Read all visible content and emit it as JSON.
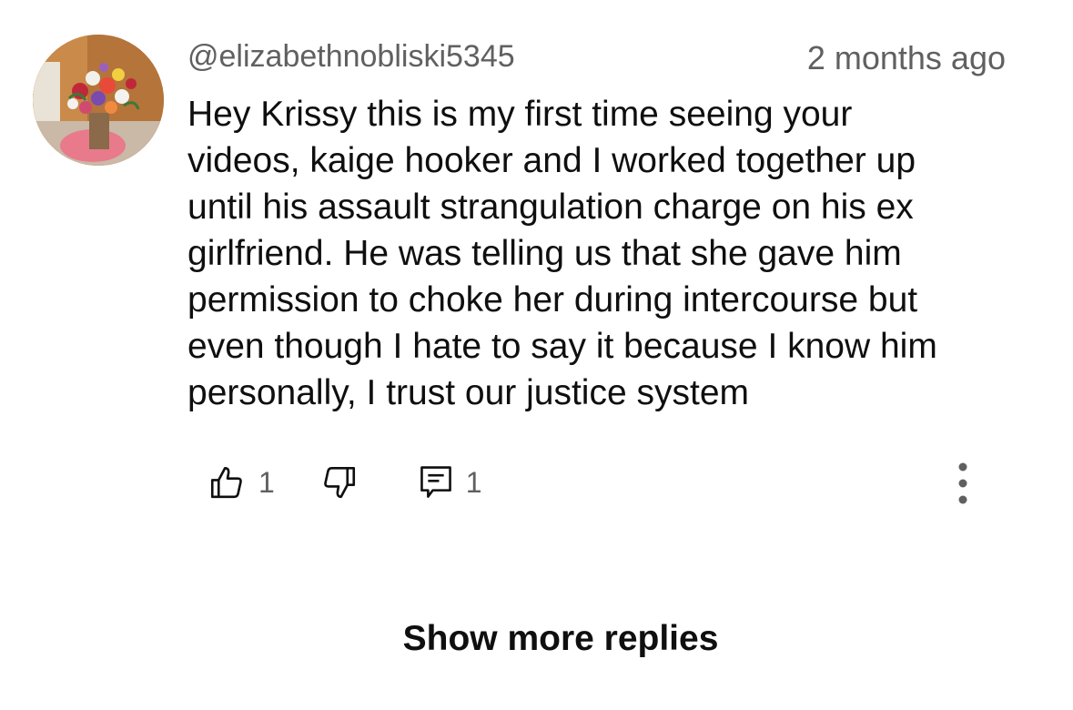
{
  "comment": {
    "author": "@elizabethnobliski5345",
    "timestamp": "2 months ago",
    "text_lines": [
      "Hey Krissy this is my first time seeing your",
      "videos, kaige hooker and I worked together up",
      "until his assault strangulation charge on his ex",
      "girlfriend. He was telling us that she gave him",
      "permission to choke her during intercourse but",
      "even though I hate to say it because I know him",
      "personally, I trust our justice system"
    ],
    "like_count": "1",
    "reply_count": "1"
  },
  "icons": {
    "like": "thumbs-up-icon",
    "dislike": "thumbs-down-icon",
    "reply": "comment-icon",
    "more": "more-vertical-icon"
  },
  "show_more_label": "Show more replies",
  "colors": {
    "text_primary": "#0f0f0f",
    "text_secondary": "#606060",
    "background": "#ffffff"
  }
}
